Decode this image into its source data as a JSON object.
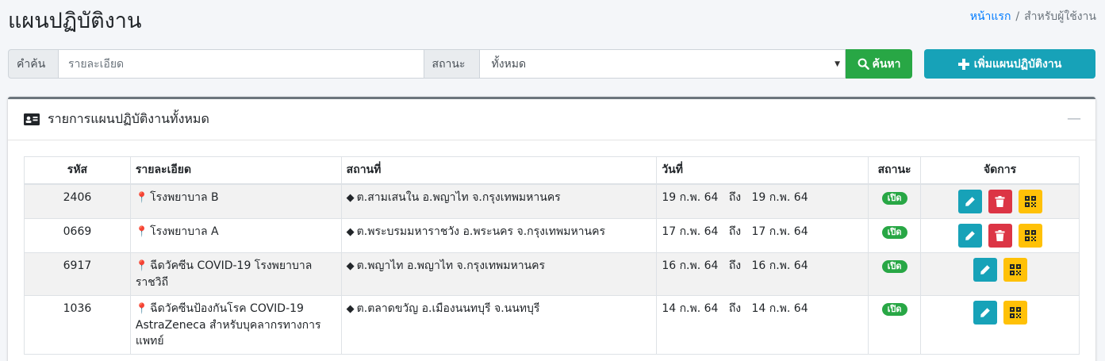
{
  "page": {
    "title": "แผนปฏิบัติงาน"
  },
  "breadcrumb": {
    "home": "หน้าแรก",
    "separator": "/",
    "current": "สำหรับผู้ใช้งาน"
  },
  "search": {
    "keyword_label": "คำค้น",
    "keyword_placeholder": "รายละเอียด",
    "keyword_value": "",
    "status_label": "สถานะ",
    "status_selected": "ทั้งหมด",
    "search_button": "ค้นหา"
  },
  "add_button": "เพิ่มแผนปฏิบัติงาน",
  "card": {
    "title": "รายการแผนปฏิบัติงานทั้งหมด",
    "collapse_symbol": "—"
  },
  "table": {
    "headers": {
      "code": "รหัส",
      "detail": "รายละเอียด",
      "place": "สถานที่",
      "date": "วันที่",
      "status": "สถานะ",
      "actions": "จัดการ"
    },
    "date_sep": "ถึง",
    "rows": [
      {
        "code": "2406",
        "detail": "โรงพยาบาล B",
        "place": "ต.สามเสนใน อ.พญาไท จ.กรุงเทพมหานคร",
        "date_from": "19 ก.พ. 64",
        "date_to": "19 ก.พ. 64",
        "status": "เปิด"
      },
      {
        "code": "0669",
        "detail": "โรงพยาบาล A",
        "place": "ต.พระบรมมหาราชวัง อ.พระนคร จ.กรุงเทพมหานคร",
        "date_from": "17 ก.พ. 64",
        "date_to": "17 ก.พ. 64",
        "status": "เปิด"
      },
      {
        "code": "6917",
        "detail": "ฉีดวัคซีน COVID-19 โรงพยาบาลราชวิถี",
        "place": "ต.พญาไท อ.พญาไท จ.กรุงเทพมหานคร",
        "date_from": "16 ก.พ. 64",
        "date_to": "16 ก.พ. 64",
        "status": "เปิด"
      },
      {
        "code": "1036",
        "detail": "ฉีดวัคซีนป้องกันโรค COVID-19 AstraZeneca สำหรับบุคลากรทางการแพทย์",
        "place": "ต.ตลาดขวัญ อ.เมืองนนทบุรี จ.นนทบุรี",
        "date_from": "14 ก.พ. 64",
        "date_to": "14 ก.พ. 64",
        "status": "เปิด"
      }
    ]
  },
  "colors": {
    "accent": "#17a2b8",
    "success": "#28a745",
    "danger": "#dc3545",
    "warning": "#ffc107",
    "link": "#007bff"
  }
}
